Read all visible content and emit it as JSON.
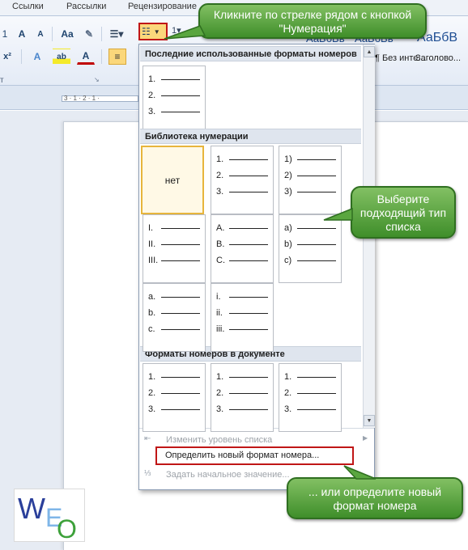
{
  "ribbon": {
    "tabs": [
      "Ссылки",
      "Рассылки",
      "Рецензирование"
    ],
    "font_buttons_row1": [
      "A",
      "A",
      "Aa"
    ],
    "font_buttons_row2": [
      "x²",
      "A",
      "ab",
      "A"
    ],
    "style_samples": [
      "АаБбВв",
      "АаБбВв",
      "АаБбВ"
    ],
    "style_names": [
      "¶ Без инте...",
      "Заголово..."
    ],
    "ruler_text": "3 · 1 · 2 · 1 ·"
  },
  "dropdown": {
    "recent_header": "Последние использованные форматы номеров",
    "recent": [
      [
        "1.",
        "2.",
        "3."
      ]
    ],
    "library_header": "Библиотека нумерации",
    "library": [
      {
        "none": "нет"
      },
      {
        "labels": [
          "1.",
          "2.",
          "3."
        ]
      },
      {
        "labels": [
          "1)",
          "2)",
          "3)"
        ]
      },
      {
        "labels": [
          "I.",
          "II.",
          "III."
        ]
      },
      {
        "labels": [
          "A.",
          "B.",
          "C."
        ]
      },
      {
        "labels": [
          "a)",
          "b)",
          "c)"
        ]
      },
      {
        "labels": [
          "a.",
          "b.",
          "c."
        ]
      },
      {
        "labels": [
          "i.",
          "ii.",
          "iii."
        ]
      }
    ],
    "document_header": "Форматы номеров в документе",
    "document": [
      [
        "1.",
        "2.",
        "3."
      ],
      [
        "1.",
        "2.",
        "3."
      ],
      [
        "1.",
        "2.",
        "3."
      ]
    ],
    "menu": {
      "change_level": "Изменить уровень списка",
      "define_new": "Определить новый формат номера...",
      "set_start": "Задать начальное значение..."
    }
  },
  "callouts": {
    "top": "Кликните по стрелке рядом с кнопкой \"Нумерация\"",
    "middle": "Выберите подходящий тип списка",
    "bottom": "... или определите новый формат номера"
  },
  "logo": {
    "text": "WEO",
    "letters": [
      "W",
      "E",
      "O"
    ]
  },
  "colors": {
    "callout_green": "#5aa63f",
    "highlight_red": "#c01616",
    "selected_gold": "#e7b53c",
    "logo_blue": "#2a3f9a",
    "logo_green": "#3da13a"
  }
}
